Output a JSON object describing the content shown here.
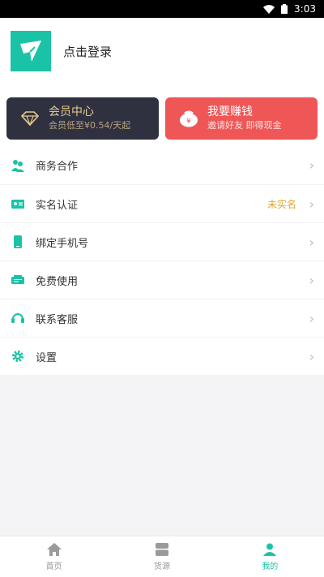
{
  "status_bar": {
    "time": "3:03"
  },
  "profile": {
    "login_label": "点击登录"
  },
  "cards": {
    "vip": {
      "title": "会员中心",
      "subtitle": "会员低至¥0.54/天起"
    },
    "earn": {
      "title": "我要赚钱",
      "subtitle": "邀请好友 即得现金"
    }
  },
  "menu": {
    "items": [
      {
        "label": "商务合作",
        "icon": "handshake-icon"
      },
      {
        "label": "实名认证",
        "icon": "id-card-icon",
        "status": "未实名"
      },
      {
        "label": "绑定手机号",
        "icon": "phone-icon"
      },
      {
        "label": "免费使用",
        "icon": "ticket-icon"
      },
      {
        "label": "联系客服",
        "icon": "headset-icon"
      },
      {
        "label": "设置",
        "icon": "gear-icon"
      }
    ]
  },
  "tabbar": {
    "tabs": [
      {
        "label": "首页",
        "icon": "home-icon"
      },
      {
        "label": "货源",
        "icon": "box-icon"
      },
      {
        "label": "我的",
        "icon": "user-icon",
        "active": true
      }
    ]
  },
  "colors": {
    "accent": "#1bc3a6",
    "vip_bg": "#2f3141",
    "earn_bg": "#ef5656",
    "status": "#e0a82e"
  }
}
